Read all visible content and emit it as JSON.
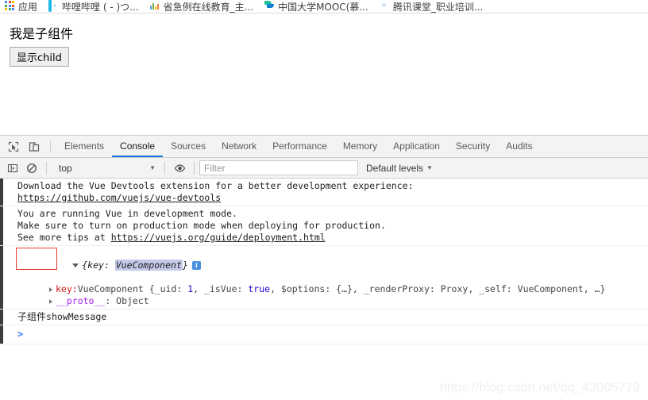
{
  "bookmarks": {
    "items": [
      {
        "icon": "apps-grid-icon",
        "label": "应用"
      },
      {
        "icon": "bilibili-icon",
        "label": "哔哩哔哩 (  -  )つ..."
      },
      {
        "icon": "bars-icon",
        "label": "省急例在线教育_主..."
      },
      {
        "icon": "mooc-icon",
        "label": "中国大学MOOC(慕..."
      },
      {
        "icon": "tencent-ketang-icon",
        "label": "腾讯课堂_职业培训..."
      }
    ]
  },
  "page": {
    "heading": "我是子组件",
    "button_label": "显示child"
  },
  "devtools": {
    "tools": {
      "inspect": "inspect-element-icon",
      "device": "toggle-device-toolbar-icon"
    },
    "tabs": [
      {
        "label": "Elements",
        "active": false
      },
      {
        "label": "Console",
        "active": true
      },
      {
        "label": "Sources",
        "active": false
      },
      {
        "label": "Network",
        "active": false
      },
      {
        "label": "Performance",
        "active": false
      },
      {
        "label": "Memory",
        "active": false
      },
      {
        "label": "Application",
        "active": false
      },
      {
        "label": "Security",
        "active": false
      },
      {
        "label": "Audits",
        "active": false
      }
    ],
    "filterbar": {
      "sidebar_icon": "console-sidebar-icon",
      "clear_icon": "clear-console-icon",
      "context_value": "top",
      "context_caret": "▼",
      "eye_icon": "live-expression-icon",
      "filter_value": "",
      "filter_placeholder": "Filter",
      "levels_label": "Default levels",
      "levels_caret": "▼"
    },
    "console": {
      "messages": [
        {
          "name": "vue-devtools-message",
          "line1": "Download the Vue Devtools extension for a better development experience:",
          "link": "https://github.com/vuejs/vue-devtools"
        },
        {
          "name": "vue-dev-mode-message",
          "line1": "You are running Vue in development mode.",
          "line2": "Make sure to turn on production mode when deploying for production.",
          "line3_prefix": "See more tips at ",
          "link": "https://vuejs.org/guide/deployment.html"
        }
      ],
      "object_log": {
        "disclosure": "▼",
        "preview_open": "{key: ",
        "preview_value": "VueComponent",
        "preview_close": "}",
        "info_badge": "i",
        "child_disclosure": "▶",
        "child_key": "key:",
        "child_class": "VueComponent",
        "child_preview_a": " {_uid: ",
        "child_uid": "1",
        "child_preview_b": ", _isVue: ",
        "child_isvue": "true",
        "child_preview_c": ", $options: {…}, _renderProxy: Proxy, _self: VueComponent, …}",
        "proto_disclosure": "▶",
        "proto_key": "__proto__",
        "proto_value": ": Object"
      },
      "last_message": {
        "cn_text": "子组件",
        "mono_text": "showMessage"
      },
      "prompt": ">"
    }
  },
  "watermark": "https://blog.csdn.net/qq_43005779",
  "colors": {
    "accent": "#1a73e8",
    "annotation": "#e8392d",
    "highlight": "#c5cae9",
    "prompt": "#2979ff"
  }
}
